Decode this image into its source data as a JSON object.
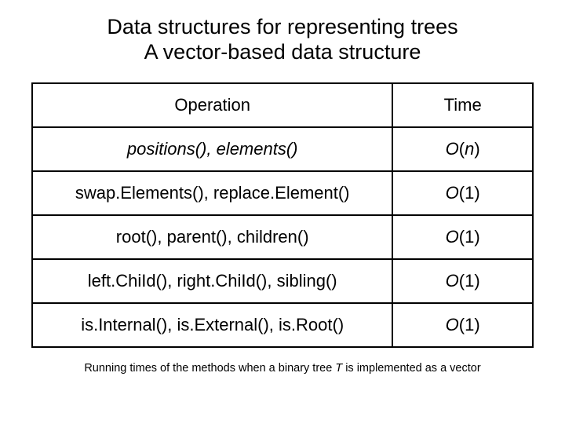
{
  "title": {
    "line1": "Data structures for representing trees",
    "line2": "A vector-based data structure"
  },
  "table": {
    "header": {
      "operation": "Operation",
      "time": "Time"
    },
    "rows": [
      {
        "op_before": "",
        "op_em": "positions(), elements()",
        "op_after": "",
        "time_o": "O",
        "time_arg": "n",
        "time_close": ")"
      },
      {
        "op_before": "swap.Elements(), replace.Element()",
        "op_em": "",
        "op_after": "",
        "time_o": "O",
        "time_arg": "1",
        "time_close": ")"
      },
      {
        "op_before": "root(), parent(), children()",
        "op_em": "",
        "op_after": "",
        "time_o": "O",
        "time_arg": "1",
        "time_close": ")"
      },
      {
        "op_before": "left.ChiId(), right.ChiId(), sibling()",
        "op_em": "",
        "op_after": "",
        "time_o": "O",
        "time_arg": "1",
        "time_close": ")"
      },
      {
        "op_before": "is.Internal(), is.External(), is.Root()",
        "op_em": "",
        "op_after": "",
        "time_o": "O",
        "time_arg": "1",
        "time_close": ")"
      }
    ]
  },
  "caption": {
    "before": "Running times of the methods when a binary tree ",
    "em": "T",
    "after": " is implemented as a vector"
  }
}
